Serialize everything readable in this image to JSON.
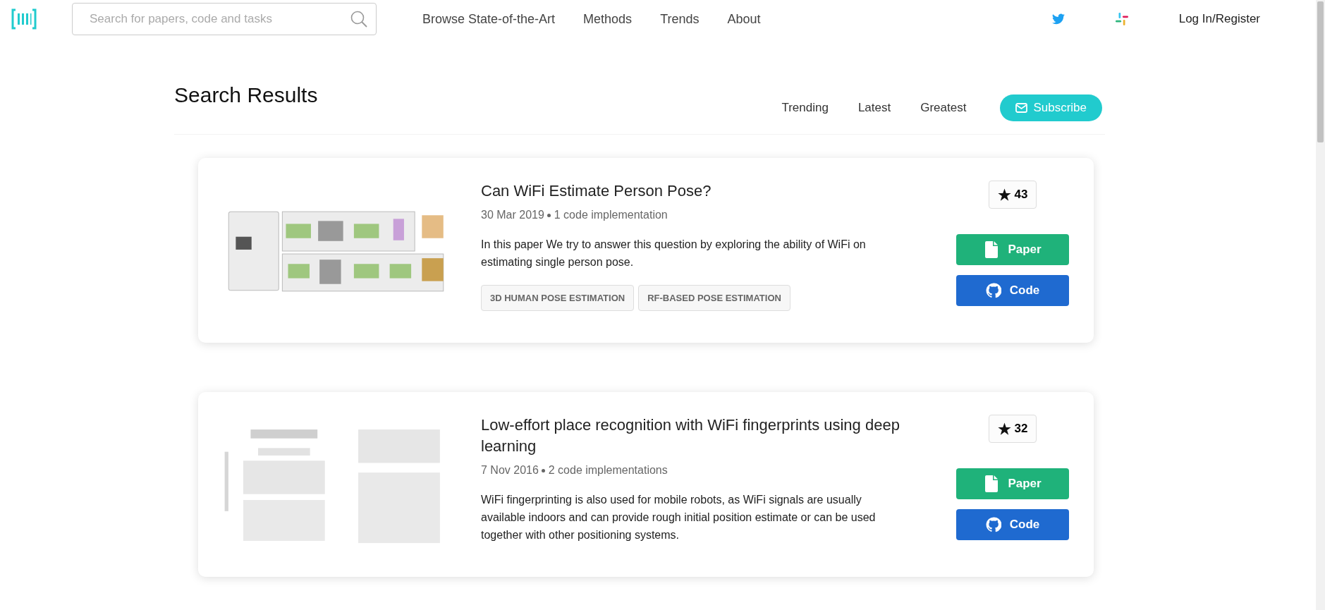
{
  "header": {
    "search": {
      "placeholder": "Search for papers, code and tasks"
    },
    "nav": [
      "Browse State-of-the-Art",
      "Methods",
      "Trends",
      "About"
    ],
    "login": "Log In/Register"
  },
  "page": {
    "title": "Search Results",
    "sort_tabs": [
      {
        "label": "Trending"
      },
      {
        "label": "Latest"
      },
      {
        "label": "Greatest"
      }
    ],
    "subscribe": "Subscribe"
  },
  "results": [
    {
      "thumbnail": {
        "kind": "picture"
      },
      "title": "Can WiFi Estimate Person Pose?",
      "date": "30 Mar 2019",
      "implementations": "1 code implementation",
      "abstract": "In this paper We try to answer this question by exploring the ability of WiFi on estimating single person pose.",
      "tags": [
        "3D HUMAN POSE ESTIMATION",
        "RF-BASED POSE ESTIMATION"
      ],
      "stars": "43",
      "paper_button": "Paper",
      "code_button": "Code"
    },
    {
      "thumbnail": {
        "kind": "picture"
      },
      "title": "Low-effort place recognition with WiFi fingerprints using deep learning",
      "date": "7 Nov 2016",
      "implementations": "2 code implementations",
      "abstract": "WiFi fingerprinting is also used for mobile robots, as WiFi signals are usually available indoors and can provide rough initial position estimate or can be used together with other positioning systems.",
      "stars": "32",
      "paper_button": "Paper",
      "code_button": "Code"
    }
  ]
}
